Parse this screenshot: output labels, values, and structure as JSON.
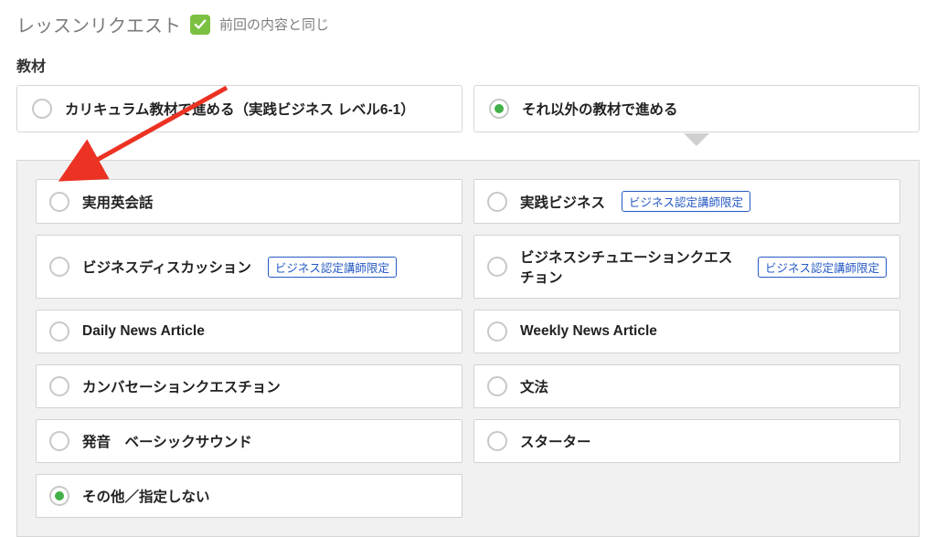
{
  "header": {
    "title": "レッスンリクエスト",
    "same_as_last_label": "前回の内容と同じ"
  },
  "materials": {
    "section_label": "教材",
    "option_a": "カリキュラム教材で進める（実践ビジネス レベル6-1）",
    "option_b": "それ以外の教材で進める"
  },
  "badges": {
    "business_only": "ビジネス認定講師限定"
  },
  "grid": {
    "r1c1": "実用英会話",
    "r1c2": "実践ビジネス",
    "r2c1": "ビジネスディスカッション",
    "r2c2": "ビジネスシチュエーションクエスチョン",
    "r3c1": "Daily News Article",
    "r3c2": "Weekly News Article",
    "r4c1": "カンバセーションクエスチョン",
    "r4c2": "文法",
    "r5c1": "発音　ベーシックサウンド",
    "r5c2": "スターター",
    "r6c1": "その他／指定しない"
  },
  "colors": {
    "accent_green": "#43b149",
    "check_green": "#7bc041",
    "panel_bg": "#f1f1f1",
    "arrow_red": "#eb3223",
    "badge_blue": "#2659c3"
  }
}
